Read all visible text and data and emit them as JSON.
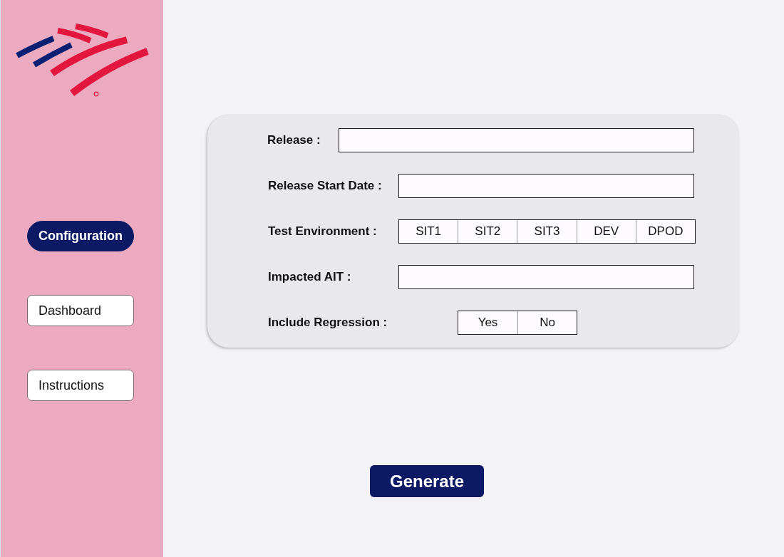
{
  "sidebar": {
    "nav": [
      {
        "label": "Configuration",
        "selected": true
      },
      {
        "label": "Dashboard",
        "selected": false
      },
      {
        "label": "Instructions",
        "selected": false
      }
    ]
  },
  "form": {
    "fields": [
      {
        "label": "Release :",
        "kind": "text"
      },
      {
        "label": "Release Start Date :",
        "kind": "text"
      },
      {
        "label": "Test Environment :",
        "kind": "choice",
        "options": [
          {
            "label": "SIT1",
            "selected": false
          },
          {
            "label": "SIT2",
            "selected": false
          },
          {
            "label": "SIT3",
            "selected": false
          },
          {
            "label": "DEV",
            "selected": false
          },
          {
            "label": "DPOD",
            "selected": false
          }
        ]
      },
      {
        "label": "Impacted AIT :",
        "kind": "text"
      },
      {
        "label": "Include Regression :",
        "kind": "choice",
        "options": [
          {
            "label": "Yes",
            "selected": false
          },
          {
            "label": "No",
            "selected": false
          }
        ]
      }
    ]
  },
  "actions": {
    "primary": "Generate"
  }
}
